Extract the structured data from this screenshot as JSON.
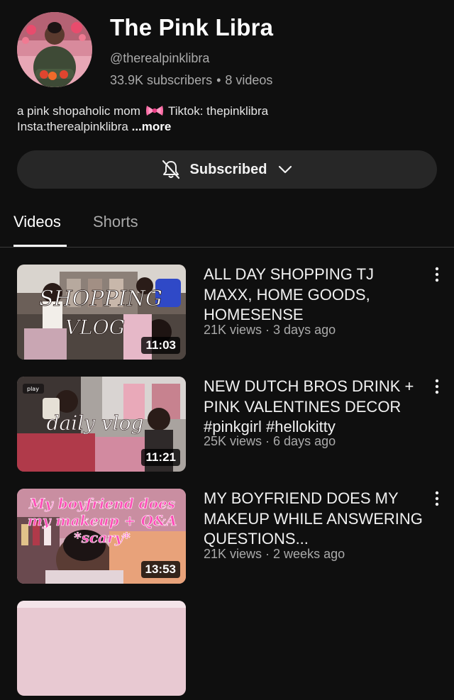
{
  "channel": {
    "title": "The Pink Libra",
    "handle": "@therealpinklibra",
    "subscribers": "33.9K subscribers",
    "separator": "•",
    "video_count": "8 videos",
    "description_part1": "a pink shopaholic mom",
    "description_part2": " Tiktok: thepinklibra",
    "description_part3": "Insta:therealpinklibra ",
    "more_label": "...more",
    "bow_icon": "pink-bow-icon"
  },
  "subscribe": {
    "label": "Subscribed",
    "bell_icon": "bell-off-icon",
    "chevron_icon": "chevron-down-icon"
  },
  "tabs": [
    {
      "label": "Videos",
      "active": true
    },
    {
      "label": "Shorts",
      "active": false
    }
  ],
  "videos": [
    {
      "title": "ALL DAY SHOPPING TJ MAXX, HOME GOODS, HOMESENSE",
      "meta": "21K views · 3 days ago",
      "duration": "11:03",
      "thumb_text_1": "SHOPPING",
      "thumb_text_2": "VLOG"
    },
    {
      "title": "NEW DUTCH BROS DRINK + PINK VALENTINES DECOR #pinkgirl #hellokitty",
      "meta": "25K views · 6 days ago",
      "duration": "11:21",
      "thumb_text_1": "daily vlog",
      "thumb_text_2": "play"
    },
    {
      "title": "MY BOYFRIEND DOES MY MAKEUP WHILE ANSWERING QUESTIONS...",
      "meta": "21K views · 2 weeks ago",
      "duration": "13:53",
      "thumb_text_1": "My boyfriend does",
      "thumb_text_2": "my makeup + Q&A",
      "thumb_text_3": "*scary*"
    }
  ],
  "colors": {
    "background": "#0f0f0f",
    "button_bg": "#272727",
    "secondary_text": "#aaaaaa",
    "accent_pink": "#ff4fb8"
  }
}
